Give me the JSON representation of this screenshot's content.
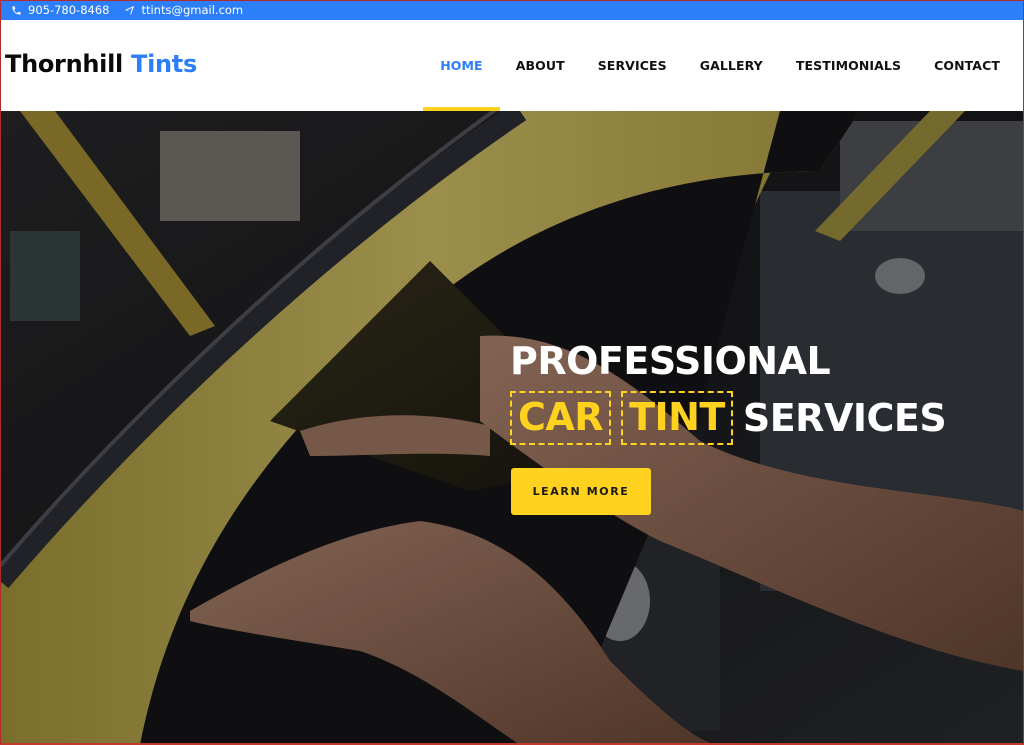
{
  "topbar": {
    "phone_icon": "phone-icon",
    "phone": "905-780-8468",
    "email_icon": "paper-plane-icon",
    "email": "ttints@gmail.com"
  },
  "brand": {
    "name_part1": "Thornhill",
    "name_part2": "Tints"
  },
  "nav": {
    "items": [
      {
        "label": "HOME",
        "active": true
      },
      {
        "label": "ABOUT",
        "active": false
      },
      {
        "label": "SERVICES",
        "active": false
      },
      {
        "label": "GALLERY",
        "active": false
      },
      {
        "label": "TESTIMONIALS",
        "active": false
      },
      {
        "label": "CONTACT",
        "active": false
      }
    ]
  },
  "hero": {
    "line1": "PROFESSIONAL",
    "boxed_word1": "CAR",
    "boxed_word2": "TINT",
    "trailing_word": "SERVICES",
    "cta_label": "LEARN MORE",
    "image_description": "hands applying tint film to a yellow car window"
  },
  "colors": {
    "brand_blue": "#2d7ff9",
    "accent_yellow": "#ffd21f",
    "text_dark": "#111111"
  }
}
